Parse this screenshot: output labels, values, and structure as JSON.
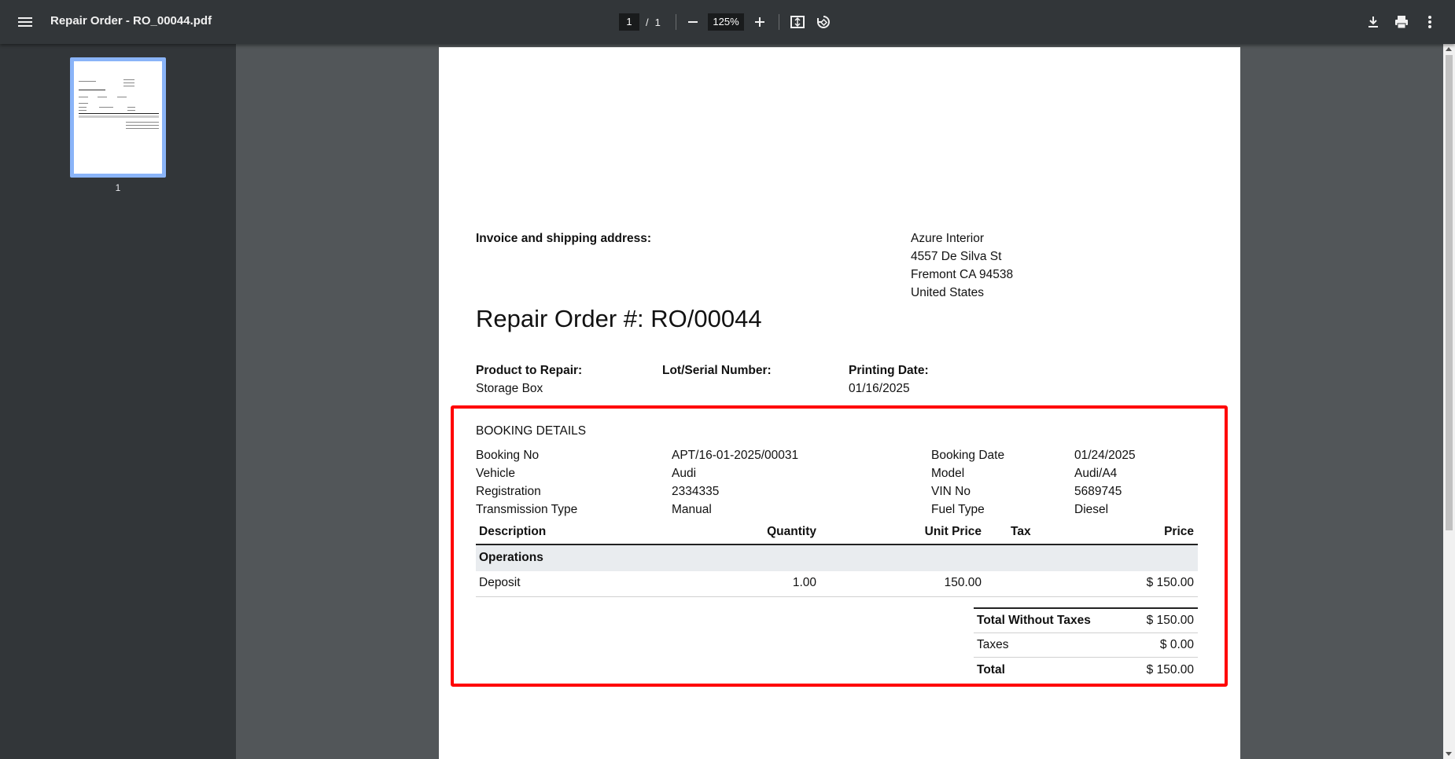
{
  "toolbar": {
    "title": "Repair Order - RO_00044.pdf",
    "current_page": "1",
    "page_separator": "/",
    "total_pages": "1",
    "zoom": "125%",
    "icons": [
      "menu-icon",
      "zoom-out-icon",
      "zoom-in-icon",
      "fit-page-icon",
      "rotate-icon",
      "download-icon",
      "print-icon",
      "more-vert-icon"
    ]
  },
  "sidebar": {
    "thumbnail_page_number": "1"
  },
  "document": {
    "address_label": "Invoice and shipping address:",
    "address_lines": [
      "Azure Interior",
      "4557 De Silva St",
      "Fremont CA 94538",
      "United States"
    ],
    "title": "Repair Order #: RO/00044",
    "product_label": "Product to Repair:",
    "product_value": "Storage Box",
    "lot_label": "Lot/Serial Number:",
    "printing_date_label": "Printing Date:",
    "printing_date_value": "01/16/2025",
    "booking_heading": "BOOKING DETAILS",
    "booking": {
      "booking_no_label": "Booking No",
      "booking_no": "APT/16-01-2025/00031",
      "booking_date_label": "Booking Date",
      "booking_date": "01/24/2025",
      "vehicle_label": "Vehicle",
      "vehicle": "Audi",
      "model_label": "Model",
      "model": "Audi/A4",
      "registration_label": "Registration",
      "registration": "2334335",
      "vin_label": "VIN No",
      "vin": "5689745",
      "transmission_label": "Transmission Type",
      "transmission": "Manual",
      "fuel_label": "Fuel Type",
      "fuel": "Diesel"
    },
    "table": {
      "headers": [
        "Description",
        "Quantity",
        "Unit Price",
        "Tax",
        "Price"
      ],
      "section": "Operations",
      "rows": [
        {
          "description": "Deposit",
          "quantity": "1.00",
          "unit_price": "150.00",
          "tax": "",
          "price": "$ 150.00"
        }
      ]
    },
    "totals": {
      "subtotal_label": "Total Without Taxes",
      "subtotal": "$ 150.00",
      "taxes_label": "Taxes",
      "taxes": "$ 0.00",
      "total_label": "Total",
      "total": "$ 150.00"
    }
  },
  "colors": {
    "highlight": "#ff0000",
    "toolbar_bg": "#323639",
    "viewer_bg": "#525659",
    "thumb_border": "#8ab4f8"
  }
}
